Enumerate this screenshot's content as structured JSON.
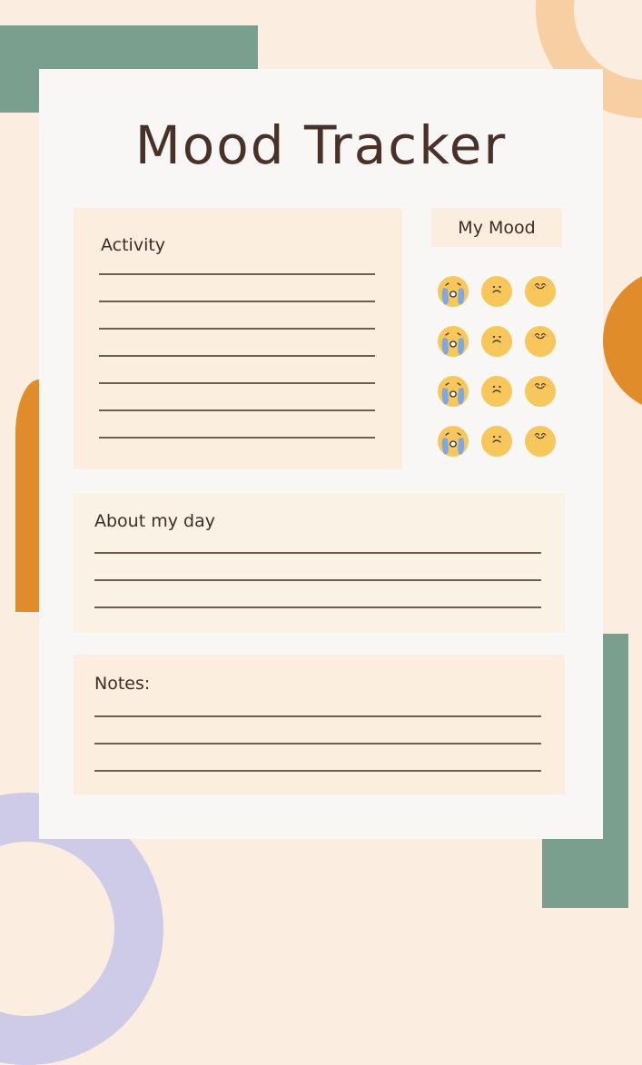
{
  "title": "Mood Tracker",
  "colors": {
    "background": "#fbeee0",
    "sheet": "#f8f7f5",
    "panel": "#fbeede",
    "text": "#4a3128",
    "green": "#7a9f8e",
    "orange": "#e08c2a",
    "peach": "#f7cfa2",
    "lavender": "#cdcbe8",
    "emoji_yellow": "#f7c75c",
    "tear_blue": "#7fa8de"
  },
  "sections": {
    "activity": {
      "label": "Activity",
      "line_count": 7
    },
    "my_mood": {
      "label": "My Mood",
      "rows": [
        [
          "crying-face-icon",
          "sad-face-icon",
          "happy-face-icon"
        ],
        [
          "crying-face-icon",
          "sad-face-icon",
          "happy-face-icon"
        ],
        [
          "crying-face-icon",
          "sad-face-icon",
          "happy-face-icon"
        ],
        [
          "crying-face-icon",
          "sad-face-icon",
          "happy-face-icon"
        ]
      ]
    },
    "about_my_day": {
      "label": "About my day",
      "line_count": 3
    },
    "notes": {
      "label": "Notes:",
      "line_count": 3
    }
  }
}
